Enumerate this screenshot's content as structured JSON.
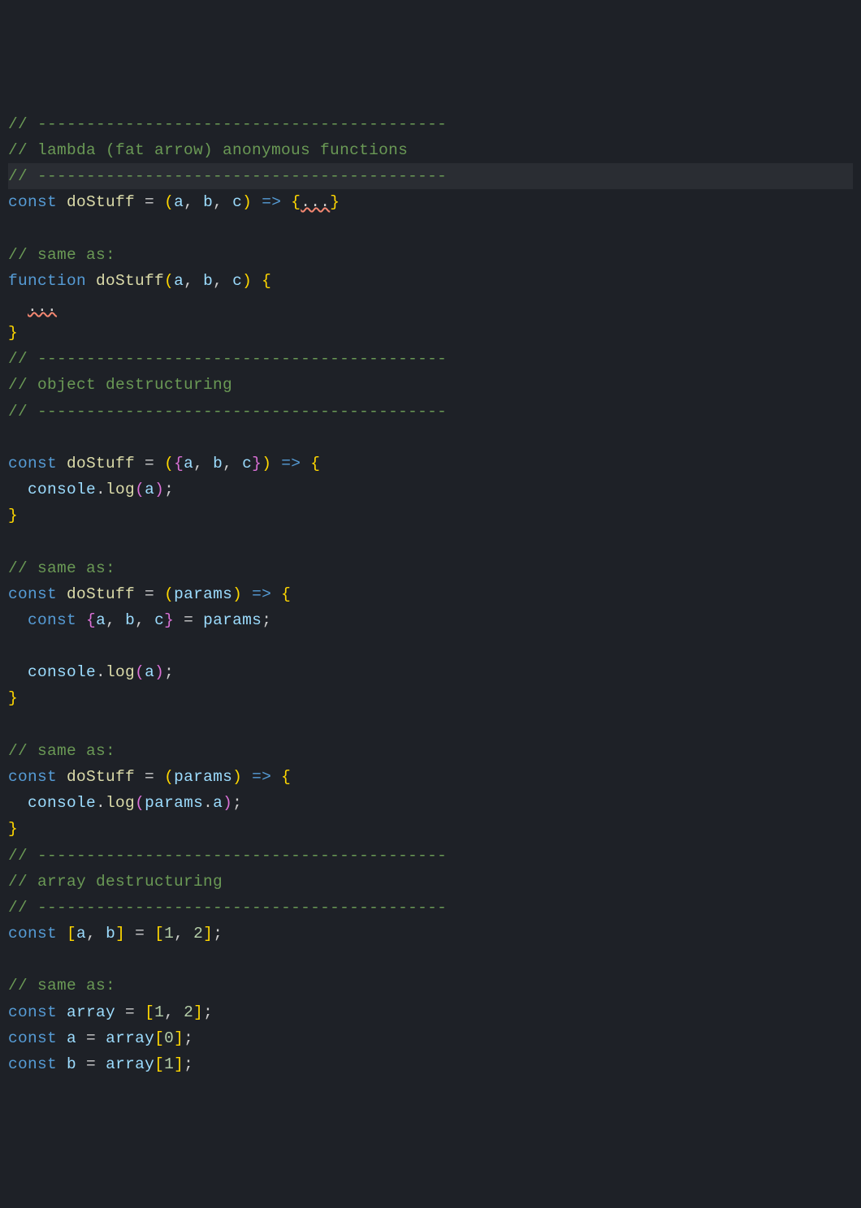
{
  "lines": {
    "l1_a": "// ",
    "l1_b": "------------------------------------------",
    "l2": "// lambda (fat arrow) anonymous functions",
    "l3_a": "// ",
    "l3_b": "------------------------------------------",
    "l4_const": "const",
    "l4_name": "doStuff",
    "l4_eq": " = ",
    "l4_lp": "(",
    "l4_a": "a",
    "l4_c1": ", ",
    "l4_b": "b",
    "l4_c2": ", ",
    "l4_c": "c",
    "l4_rp": ")",
    "l4_sp": " ",
    "l4_ar": "=>",
    "l4_sp2": " ",
    "l4_lb": "{",
    "l4_dots": "...",
    "l4_rb": "}",
    "l6": "// same as:",
    "l7_fn": "function",
    "l7_sp": " ",
    "l7_name": "doStuff",
    "l7_lp": "(",
    "l7_a": "a",
    "l7_c1": ", ",
    "l7_b": "b",
    "l7_c2": ", ",
    "l7_c": "c",
    "l7_rp": ")",
    "l7_sp2": " ",
    "l7_lb": "{",
    "l8_guide": "  ",
    "l8_dots": "...",
    "l9_rb": "}",
    "l10_a": "// ",
    "l10_b": "------------------------------------------",
    "l11": "// object destructuring",
    "l12_a": "// ",
    "l12_b": "------------------------------------------",
    "l14_const": "const",
    "l14_name": "doStuff",
    "l14_eq": " = ",
    "l14_lp": "(",
    "l14_lb": "{",
    "l14_a": "a",
    "l14_c1": ", ",
    "l14_b": "b",
    "l14_c2": ", ",
    "l14_c": "c",
    "l14_rb": "}",
    "l14_rp": ")",
    "l14_sp": " ",
    "l14_ar": "=>",
    "l14_sp2": " ",
    "l14_lbb": "{",
    "l15_ind": "  ",
    "l15_con": "console",
    "l15_dot": ".",
    "l15_log": "log",
    "l15_lp": "(",
    "l15_a": "a",
    "l15_rp": ")",
    "l15_sc": ";",
    "l16_rb": "}",
    "l18": "// same as:",
    "l19_const": "const",
    "l19_name": "doStuff",
    "l19_eq": " = ",
    "l19_lp": "(",
    "l19_p": "params",
    "l19_rp": ")",
    "l19_sp": " ",
    "l19_ar": "=>",
    "l19_sp2": " ",
    "l19_lb": "{",
    "l20_ind": "  ",
    "l20_const": "const",
    "l20_sp": " ",
    "l20_lb": "{",
    "l20_a": "a",
    "l20_c1": ", ",
    "l20_b": "b",
    "l20_c2": ", ",
    "l20_c": "c",
    "l20_rb": "}",
    "l20_eq": " = ",
    "l20_p": "params",
    "l20_sc": ";",
    "l22_ind": "  ",
    "l22_con": "console",
    "l22_dot": ".",
    "l22_log": "log",
    "l22_lp": "(",
    "l22_a": "a",
    "l22_rp": ")",
    "l22_sc": ";",
    "l23_rb": "}",
    "l25": "// same as:",
    "l26_const": "const",
    "l26_name": "doStuff",
    "l26_eq": " = ",
    "l26_lp": "(",
    "l26_p": "params",
    "l26_rp": ")",
    "l26_sp": " ",
    "l26_ar": "=>",
    "l26_sp2": " ",
    "l26_lb": "{",
    "l27_ind": "  ",
    "l27_con": "console",
    "l27_dot": ".",
    "l27_log": "log",
    "l27_lp": "(",
    "l27_p": "params",
    "l27_dot2": ".",
    "l27_a": "a",
    "l27_rp": ")",
    "l27_sc": ";",
    "l28_rb": "}",
    "l29_a": "// ",
    "l29_b": "------------------------------------------",
    "l30": "// array destructuring",
    "l31_a": "// ",
    "l31_b": "------------------------------------------",
    "l32_const": "const",
    "l32_sp": " ",
    "l32_lb": "[",
    "l32_a": "a",
    "l32_c1": ", ",
    "l32_b": "b",
    "l32_rb": "]",
    "l32_eq": " = ",
    "l32_lb2": "[",
    "l32_1": "1",
    "l32_c2": ", ",
    "l32_2": "2",
    "l32_rb2": "]",
    "l32_sc": ";",
    "l34": "// same as:",
    "l35_const": "const",
    "l35_sp": " ",
    "l35_arr": "array",
    "l35_eq": " = ",
    "l35_lb": "[",
    "l35_1": "1",
    "l35_c1": ", ",
    "l35_2": "2",
    "l35_rb": "]",
    "l35_sc": ";",
    "l36_const": "const",
    "l36_sp": " ",
    "l36_a": "a",
    "l36_eq": " = ",
    "l36_arr": "array",
    "l36_lb": "[",
    "l36_0": "0",
    "l36_rb": "]",
    "l36_sc": ";",
    "l37_const": "const",
    "l37_sp": " ",
    "l37_b": "b",
    "l37_eq": " = ",
    "l37_arr": "array",
    "l37_lb": "[",
    "l37_1": "1",
    "l37_rb": "]",
    "l37_sc": ";"
  }
}
